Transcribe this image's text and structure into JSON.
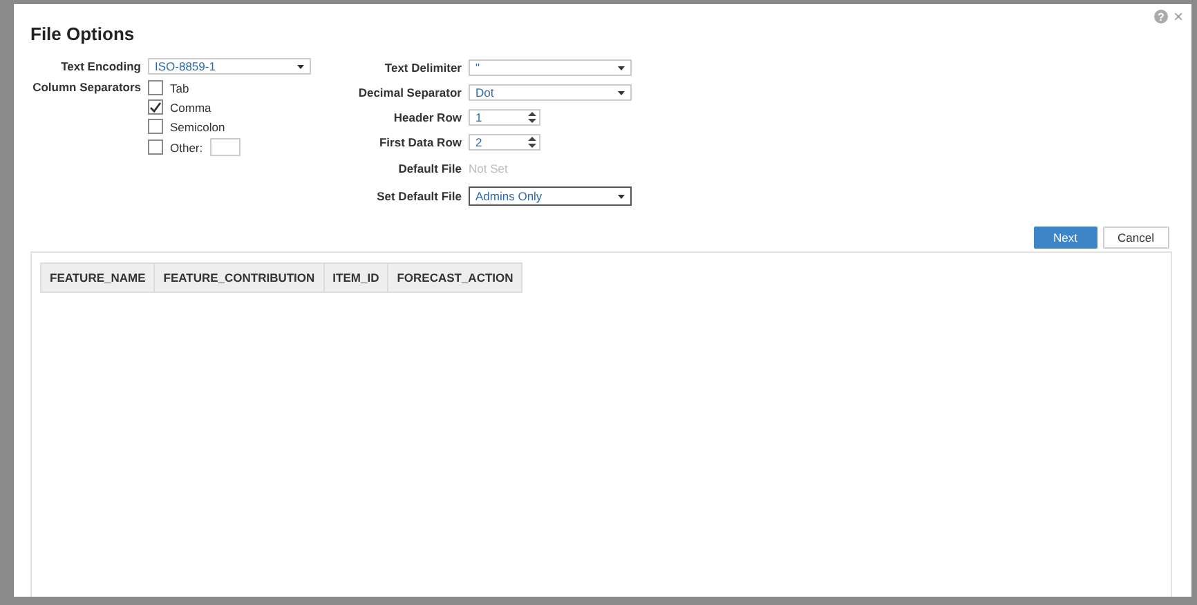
{
  "dialog": {
    "title": "File Options",
    "help": "?",
    "close": "×"
  },
  "left_form": {
    "text_encoding": {
      "label": "Text Encoding",
      "value": "ISO-8859-1"
    },
    "column_separators": {
      "label": "Column Separators",
      "options": [
        {
          "label": "Tab",
          "checked": false,
          "kind": "check"
        },
        {
          "label": "Comma",
          "checked": true,
          "kind": "check"
        },
        {
          "label": "Semicolon",
          "checked": false,
          "kind": "check"
        },
        {
          "label": "Other:",
          "checked": false,
          "kind": "other"
        }
      ]
    }
  },
  "right_form": [
    {
      "kind": "select",
      "label": "Text Delimiter",
      "value": "\""
    },
    {
      "kind": "select",
      "label": "Decimal Separator",
      "value": "Dot"
    },
    {
      "kind": "spinner",
      "label": "Header Row",
      "value": "1"
    },
    {
      "kind": "spinner",
      "label": "First Data Row",
      "value": "2"
    },
    {
      "kind": "static",
      "label": "Default File",
      "value": "Not Set"
    },
    {
      "kind": "select",
      "label": "Set Default File",
      "value": "Admins Only",
      "focused": true
    }
  ],
  "buttons": [
    {
      "label": "Next",
      "primary": true
    },
    {
      "label": "Cancel",
      "primary": false
    }
  ],
  "preview_table": {
    "columns": [
      "FEATURE_NAME",
      "FEATURE_CONTRIBUTION",
      "ITEM_ID",
      "FORECAST_ACTION"
    ]
  }
}
